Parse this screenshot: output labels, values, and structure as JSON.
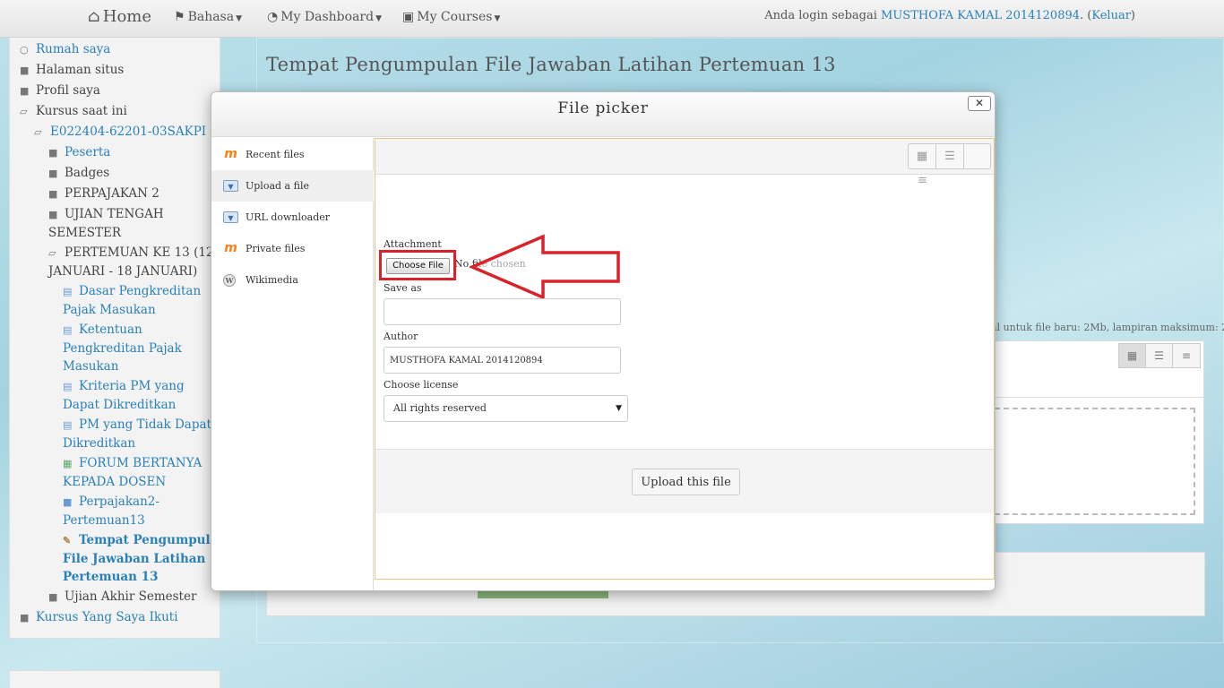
{
  "navbar": {
    "home": "Home",
    "bahasa": "Bahasa",
    "dashboard": "My Dashboard",
    "courses": "My Courses",
    "login_prefix": "Anda login sebagai ",
    "user_name": "MUSTHOFA KAMAL 2014120894",
    "logout_open": ". (",
    "logout": "Keluar",
    "logout_close": ")"
  },
  "sidebar": {
    "items": [
      {
        "label": "Rumah saya",
        "icon": "circle-icon"
      },
      {
        "label": "Halaman situs",
        "icon": "folder-icon"
      },
      {
        "label": "Profil saya",
        "icon": "folder-icon"
      },
      {
        "label": "Kursus saat ini",
        "icon": "folder-open-icon"
      },
      {
        "label": "E022404-62201-03SAKPI",
        "icon": "folder-open-icon"
      },
      {
        "label": "Peserta",
        "icon": "folder-icon"
      },
      {
        "label": "Badges",
        "icon": "folder-icon"
      },
      {
        "label": "PERPAJAKAN 2",
        "icon": "folder-icon"
      },
      {
        "label_1": "UJIAN TENGAH",
        "label_2": "SEMESTER",
        "icon": "folder-icon"
      },
      {
        "label_1": "PERTEMUAN KE 13 (12",
        "label_2": "JANUARI - 18 JANUARI)",
        "icon": "folder-open-icon"
      },
      {
        "label_1": "Dasar Pengkreditan",
        "label_2": "Pajak Masukan",
        "icon": "document-icon"
      },
      {
        "label_1": "Ketentuan",
        "label_2": "Pengkreditan Pajak",
        "label_3": "Masukan",
        "icon": "document-icon"
      },
      {
        "label_1": "Kriteria PM yang",
        "label_2": "Dapat Dikreditkan",
        "icon": "document-icon"
      },
      {
        "label_1": "PM yang Tidak Dapat",
        "label_2": "Dikreditkan",
        "icon": "document-icon"
      },
      {
        "label_1": "FORUM BERTANYA",
        "label_2": "KEPADA DOSEN",
        "icon": "forum-icon"
      },
      {
        "label_1": "Perpajakan2-",
        "label_2": "Pertemuan13",
        "icon": "folder-icon"
      },
      {
        "label_1": "Tempat Pengumpulan",
        "label_2": "File Jawaban Latihan",
        "label_3": "Pertemuan 13",
        "icon": "assignment-icon"
      },
      {
        "label": "Ujian Akhir Semester",
        "icon": "folder-icon"
      },
      {
        "label": "Kursus Yang Saya Ikuti",
        "icon": "folder-icon"
      }
    ]
  },
  "page": {
    "title": "Tempat Pengumpulan File Jawaban Latihan Pertemuan 13",
    "bg_info": "al untuk file baru: 2Mb, lampiran maksimum: 2"
  },
  "modal": {
    "title": "File picker",
    "close": "✕",
    "repositories": [
      {
        "label": "Recent files",
        "icon": "moodle-icon"
      },
      {
        "label": "Upload a file",
        "icon": "upload-icon",
        "selected": true
      },
      {
        "label": "URL downloader",
        "icon": "url-download-icon"
      },
      {
        "label": "Private files",
        "icon": "moodle-icon"
      },
      {
        "label": "Wikimedia",
        "icon": "wikimedia-icon"
      }
    ],
    "form": {
      "attachment_label": "Attachment",
      "choose_file": "Choose File",
      "no_file": "No file chosen",
      "save_as_label": "Save as",
      "save_as_value": "",
      "author_label": "Author",
      "author_value": "MUSTHOFA KAMAL 2014120894",
      "license_label": "Choose license",
      "license_value": "All rights reserved",
      "upload_button": "Upload this file"
    }
  },
  "colors": {
    "highlight": "#d8232a",
    "link": "#2a80b9",
    "panel_border": "#e3c48b"
  }
}
